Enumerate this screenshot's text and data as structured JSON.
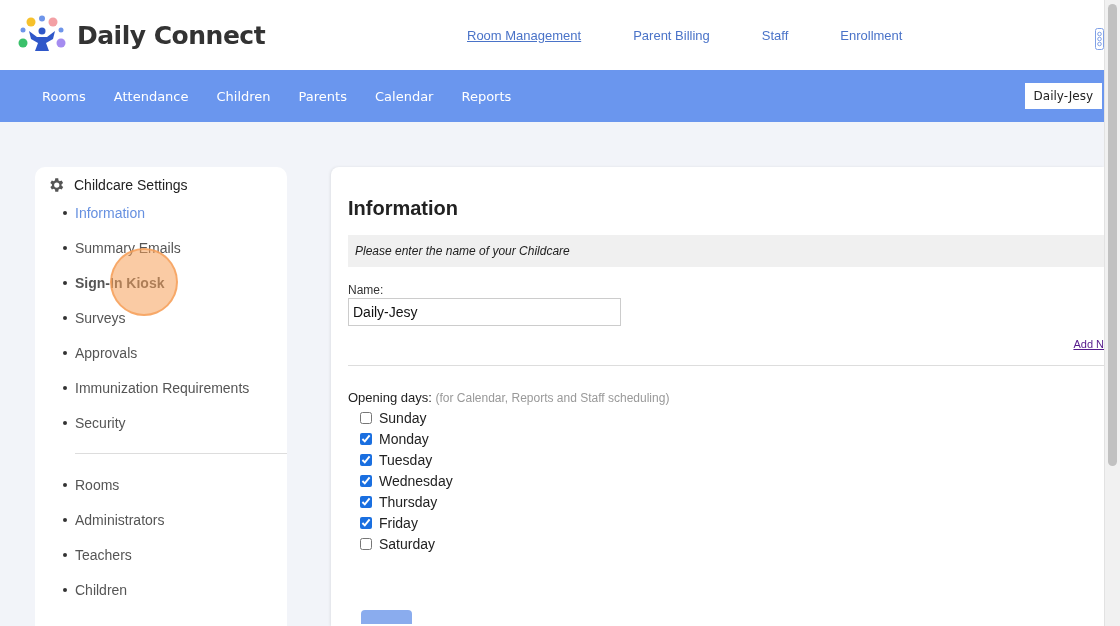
{
  "brand": {
    "name": "Daily Connect"
  },
  "top_links": [
    {
      "label": "Room Management",
      "selected": true
    },
    {
      "label": "Parent Billing",
      "selected": false
    },
    {
      "label": "Staff",
      "selected": false
    },
    {
      "label": "Enrollment",
      "selected": false
    }
  ],
  "nav": {
    "items": [
      "Rooms",
      "Attendance",
      "Children",
      "Parents",
      "Calendar",
      "Reports"
    ],
    "account": "Daily-Jesy"
  },
  "sidebar": {
    "title": "Childcare Settings",
    "groups": [
      [
        {
          "label": "Information",
          "selected": true,
          "clicked": false
        },
        {
          "label": "Summary Emails",
          "selected": false,
          "clicked": false
        },
        {
          "label": "Sign-In Kiosk",
          "selected": false,
          "clicked": true
        },
        {
          "label": "Surveys",
          "selected": false,
          "clicked": false
        },
        {
          "label": "Approvals",
          "selected": false,
          "clicked": false
        },
        {
          "label": "Immunization Requirements",
          "selected": false,
          "clicked": false
        },
        {
          "label": "Security",
          "selected": false,
          "clicked": false
        }
      ],
      [
        {
          "label": "Rooms",
          "selected": false,
          "clicked": false
        },
        {
          "label": "Administrators",
          "selected": false,
          "clicked": false
        },
        {
          "label": "Teachers",
          "selected": false,
          "clicked": false
        },
        {
          "label": "Children",
          "selected": false,
          "clicked": false
        }
      ]
    ]
  },
  "main": {
    "title": "Information",
    "instruction": "Please enter the name of your Childcare",
    "name_field": {
      "label": "Name:",
      "value": "Daily-Jesy"
    },
    "add_link": "Add N",
    "opening_days": {
      "label": "Opening days:",
      "note": "(for Calendar, Reports and Staff scheduling)",
      "days": [
        {
          "label": "Sunday",
          "checked": false
        },
        {
          "label": "Monday",
          "checked": true
        },
        {
          "label": "Tuesday",
          "checked": true
        },
        {
          "label": "Wednesday",
          "checked": true
        },
        {
          "label": "Thursday",
          "checked": true
        },
        {
          "label": "Friday",
          "checked": true
        },
        {
          "label": "Saturday",
          "checked": false
        }
      ]
    }
  }
}
